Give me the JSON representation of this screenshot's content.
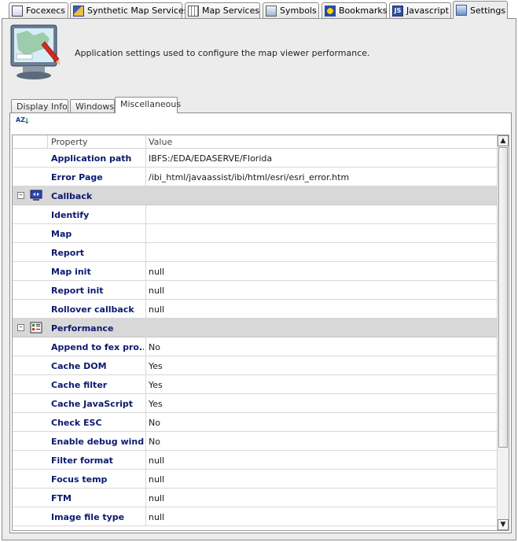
{
  "top_tabs": [
    {
      "label": "Focexecs",
      "icon": "focexec-icon"
    },
    {
      "label": "Synthetic Map Services",
      "icon": "synthetic-map-icon"
    },
    {
      "label": "Map Services",
      "icon": "map-services-icon"
    },
    {
      "label": "Symbols",
      "icon": "symbols-icon"
    },
    {
      "label": "Bookmarks",
      "icon": "bookmarks-icon"
    },
    {
      "label": "Javascript",
      "icon": "javascript-icon"
    },
    {
      "label": "Settings",
      "icon": "settings-icon",
      "active": true
    }
  ],
  "description": "Application settings used to configure the map viewer performance.",
  "sub_tabs": [
    {
      "label": "Display Info"
    },
    {
      "label": "Windows"
    },
    {
      "label": "Miscellaneous",
      "active": true
    }
  ],
  "grid": {
    "col_property": "Property",
    "col_value": "Value",
    "rows": [
      {
        "name": "Application path",
        "value": "IBFS:/EDA/EDASERVE/Florida"
      },
      {
        "name": "Error Page",
        "value": "/ibi_html/javaassist/ibi/html/esri/esri_error.htm"
      },
      {
        "name": "Callback",
        "category": true,
        "toggle": "⊟"
      },
      {
        "name": "Identify",
        "value": ""
      },
      {
        "name": "Map",
        "value": ""
      },
      {
        "name": "Report",
        "value": ""
      },
      {
        "name": "Map init",
        "value": "null"
      },
      {
        "name": "Report init",
        "value": "null"
      },
      {
        "name": "Rollover callback",
        "value": "null"
      },
      {
        "name": "Performance",
        "category": true,
        "toggle": "⊟"
      },
      {
        "name": "Append to fex pro...",
        "value": "No"
      },
      {
        "name": "Cache DOM",
        "value": "Yes"
      },
      {
        "name": "Cache filter",
        "value": "Yes"
      },
      {
        "name": "Cache JavaScript",
        "value": "Yes"
      },
      {
        "name": "Check ESC",
        "value": "No"
      },
      {
        "name": "Enable debug wind...",
        "value": "No"
      },
      {
        "name": "Filter format",
        "value": "null"
      },
      {
        "name": "Focus temp",
        "value": "null"
      },
      {
        "name": "FTM",
        "value": "null"
      },
      {
        "name": "Image file type",
        "value": "null"
      }
    ]
  },
  "sort_icon_text": "AZ",
  "colors": {
    "panel_bg": "#ececec",
    "category_bg": "#d8d8d8",
    "property_text": "#0b1a6e"
  }
}
